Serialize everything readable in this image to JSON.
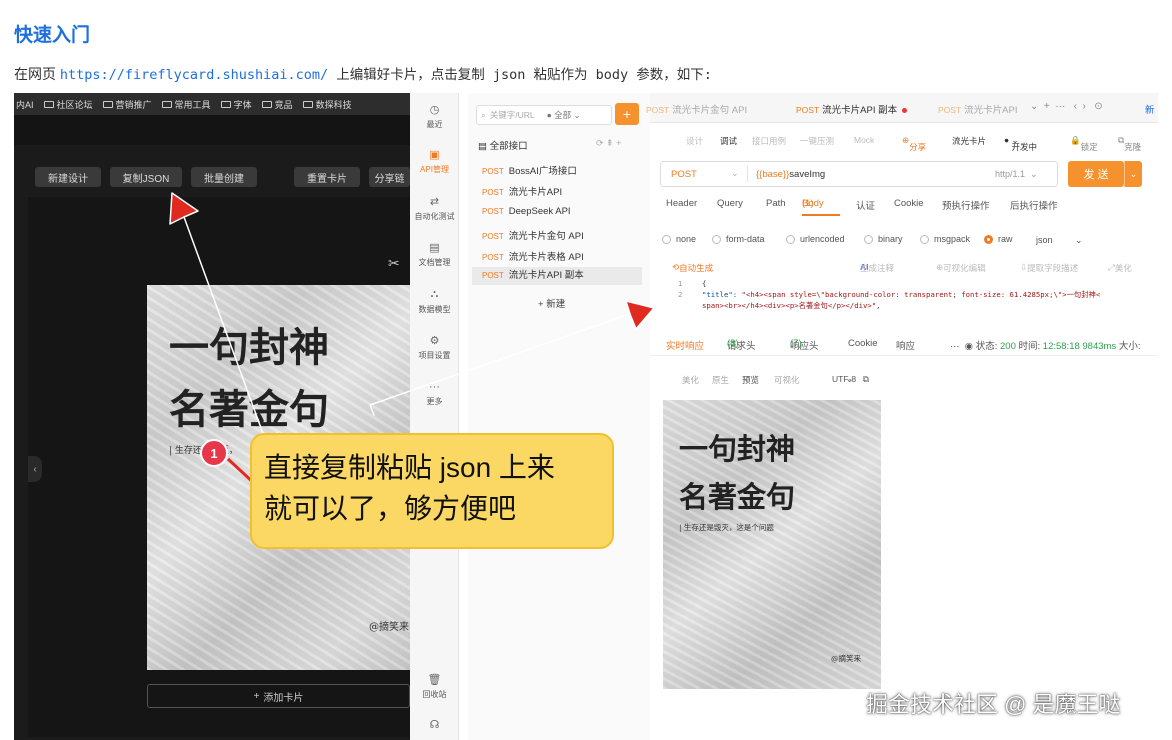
{
  "article": {
    "heading": "快速入门",
    "intro_before": "在网页 ",
    "intro_link": "https://fireflycard.shushiai.com/",
    "intro_after": " 上编辑好卡片，点击复制 json 粘贴作为 body 参数，如下:"
  },
  "browser_bookmarks": [
    "内AI",
    "社区论坛",
    "营销推广",
    "常用工具",
    "字体",
    "竞品",
    "数探科技"
  ],
  "editor": {
    "buttons": [
      "新建设计",
      "复制JSON",
      "批量创建",
      "重置卡片",
      "分享链"
    ],
    "add_card": "添加卡片",
    "poster": {
      "line1": "一句封神",
      "line2": "名著金句",
      "subtitle": "| 生存还是毁灭，",
      "author": "@摘笑来"
    }
  },
  "api_tool": {
    "nav": [
      {
        "label": "最近",
        "icon": "clock-icon"
      },
      {
        "label": "API管理",
        "icon": "api-icon"
      },
      {
        "label": "自动化测试",
        "icon": "automation-icon"
      },
      {
        "label": "文档管理",
        "icon": "document-icon"
      },
      {
        "label": "数据模型",
        "icon": "model-icon"
      },
      {
        "label": "项目设置",
        "icon": "settings-icon"
      },
      {
        "label": "更多",
        "icon": "more-icon"
      },
      {
        "label": "回收站",
        "icon": "trash-icon"
      },
      {
        "label": "",
        "icon": "headset-icon"
      }
    ],
    "search_placeholder": "关键字/URL",
    "search_scope": "全部",
    "all_interfaces": "全部接口",
    "api_list": [
      {
        "method": "POST",
        "name": "BossAI广场接口"
      },
      {
        "method": "POST",
        "name": "流光卡片API"
      },
      {
        "method": "POST",
        "name": "DeepSeek API"
      },
      {
        "method": "POST",
        "name": "流光卡片金句 API"
      },
      {
        "method": "POST",
        "name": "流光卡片表格 API"
      },
      {
        "method": "POST",
        "name": "流光卡片API 副本"
      }
    ],
    "new_label": "新建",
    "tabs": [
      {
        "method": "POST",
        "name": "流光卡片金句 API"
      },
      {
        "method": "POST",
        "name": "流光卡片API 副本"
      },
      {
        "method": "POST",
        "name": "流光卡片API"
      }
    ],
    "tab_new": "新",
    "subtabs": [
      "设计",
      "调试",
      "接口用例",
      "一键压测",
      "Mock"
    ],
    "share": "分享",
    "project_name": "流光卡片",
    "env": "开发中",
    "lock": "锁定",
    "pin": "克隆",
    "method": "POST",
    "url_base": "{{base}}",
    "url_path": "saveImg",
    "protocol": "http/1.1",
    "send": "发 送",
    "request_tabs": [
      "Header",
      "Query",
      "Path",
      "Body",
      "(1)",
      "认证",
      "Cookie",
      "预执行操作",
      "后执行操作"
    ],
    "body_types": [
      "none",
      "form-data",
      "urlencoded",
      "binary",
      "msgpack",
      "raw"
    ],
    "raw_format": "json",
    "body_tools": [
      "自动生成",
      "AI",
      "生成注释",
      "可视化编辑",
      "提取字段描述",
      "美化"
    ],
    "code_lines": [
      {
        "num": "1",
        "text": "{"
      },
      {
        "num": "2",
        "key": "\"title\": ",
        "value": "\"<h4><span style=\\\"background-color: transparent; font-size: 61.4285px;\\\">一句封神<"
      },
      {
        "num": "",
        "text": "span><br></h4><div><p>名著金句</p></div>\","
      }
    ],
    "response_tabs": [
      "实时响应",
      "请求头",
      "(8)",
      "响应头",
      "(7)",
      "Cookie",
      "响应"
    ],
    "status_label": "状态:",
    "status_code": "200",
    "time_label": "时间:",
    "time_value": "12:58:18 9843ms",
    "size_label": "大小:",
    "view_tools": [
      "美化",
      "原生",
      "预览",
      "可视化",
      "UTF-8"
    ],
    "preview_poster": {
      "line1": "一句封神",
      "line2": "名著金句",
      "subtitle": "| 生存还是毁灭，这是个问题",
      "author": "@摘笑来"
    }
  },
  "overlay": {
    "badge": "1",
    "callout_line1": "直接复制粘贴 json 上来",
    "callout_line2": "就可以了，够方便吧",
    "watermark": "掘金技术社区 @ 是魔王哒",
    "arrow_color": "#e02a20",
    "callout_color": "#fbd864"
  }
}
